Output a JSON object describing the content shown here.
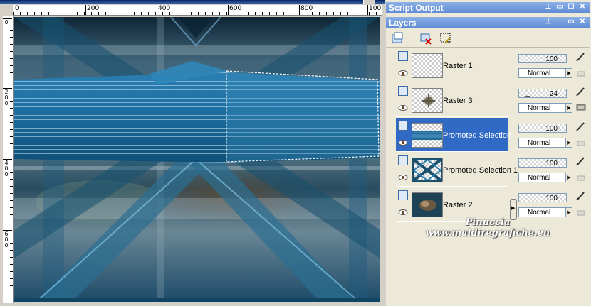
{
  "document": {
    "ruler_top_ticks": [
      "0",
      "200",
      "400",
      "600",
      "800",
      "100"
    ],
    "ruler_left_ticks": [
      "0",
      "2\n0\n0",
      "4\n0\n0",
      "6\n0\n0"
    ],
    "close_glyph": "✕"
  },
  "script_output": {
    "title": "Script Output",
    "buttons": [
      "⊥",
      "▭",
      "☐",
      "✕"
    ]
  },
  "layers": {
    "title": "Layers",
    "buttons": [
      "⊥",
      "−",
      "▭",
      "✕"
    ],
    "items": [
      {
        "name": "Raster 1",
        "opacity": "100",
        "blend": "Normal",
        "selected": false
      },
      {
        "name": "Raster 3",
        "opacity": "24",
        "blend": "Normal",
        "selected": false
      },
      {
        "name": "Promoted Selection",
        "opacity": "100",
        "blend": "Normal",
        "selected": true
      },
      {
        "name": "Promoted Selection 1",
        "opacity": "100",
        "blend": "Normal",
        "selected": false
      },
      {
        "name": "Raster 2",
        "opacity": "100",
        "blend": "Normal",
        "selected": false
      }
    ]
  },
  "watermark": {
    "line1": "Pinuccia",
    "line2": "www.maldiregrafiche.eu"
  },
  "colors": {
    "selection": "#316ac5",
    "palette_title": "#6b94dc",
    "canvas_main": "#1e5f80"
  }
}
